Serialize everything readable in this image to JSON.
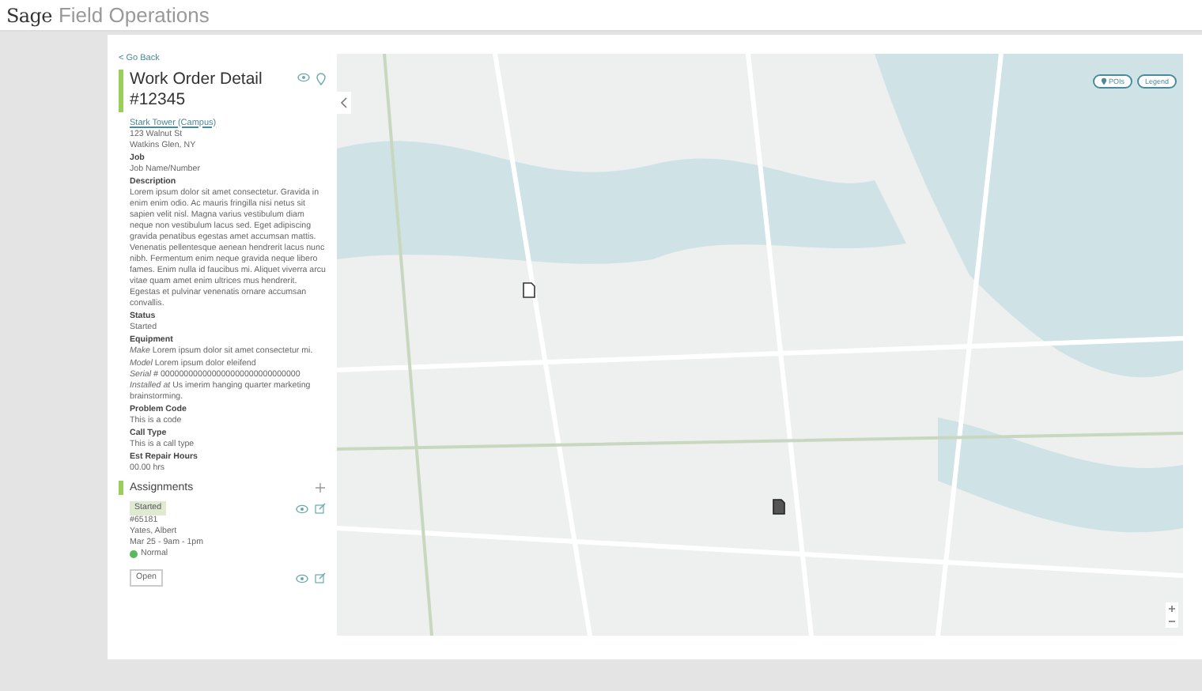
{
  "header": {
    "logo": "Sage",
    "title": "Field Operations"
  },
  "detail": {
    "back": "< Go Back",
    "title": "Work Order Detail",
    "number": "#12345",
    "site_link": "Stark Tower (Campus)",
    "address": [
      "123 Walnut St",
      "Watkins Glen, NY"
    ],
    "fields": [
      {
        "label": "Job",
        "value": "Job Name/Number"
      },
      {
        "label": "Description",
        "value": "Lorem ipsum dolor sit amet consectetur. Gravida in enim enim odio. Ac mauris fringilla nisi netus sit sapien velit nisl. Magna varius vestibulum diam neque non vestibulum lacus sed. Eget adipiscing gravida penatibus egestas amet accumsan mattis. Venenatis pellentesque aenean hendrerit lacus nunc nibh. Fermentum enim neque gravida neque libero fames. Enim nulla id faucibus mi. Aliquet viverra arcu vitae quam amet enim ultrices mus hendrerit. Egestas et pulvinar venenatis ornare accumsan convallis."
      },
      {
        "label": "Status",
        "value": "Started"
      }
    ],
    "equipment": {
      "label": "Equipment",
      "lines": [
        {
          "key": "Make",
          "value": "Lorem ipsum dolor sit amet consectetur mi."
        },
        {
          "key": "Model",
          "value": "Lorem ipsum dolor eleifend"
        },
        {
          "key": "Serial #",
          "value": "000000000000000000000000000000"
        },
        {
          "key": "Installed at",
          "value": "Us imerim hanging quarter marketing brainstorming."
        }
      ]
    },
    "fields2": [
      {
        "label": "Problem Code",
        "value": "This is a code"
      },
      {
        "label": "Call Type",
        "value": "This is a call type"
      },
      {
        "label": "Est Repair Hours",
        "value": "00.00 hrs"
      }
    ]
  },
  "assignments": {
    "title": "Assignments",
    "items": [
      {
        "status": "Started",
        "kind": "full",
        "number": "#65181",
        "name": "Yates, Albert",
        "time": "Mar 25 - 9am - 1pm",
        "priority": "Normal"
      },
      {
        "status": "Open",
        "kind": "short"
      }
    ]
  },
  "map": {
    "buttons": [
      "POIs",
      "Legend"
    ]
  }
}
